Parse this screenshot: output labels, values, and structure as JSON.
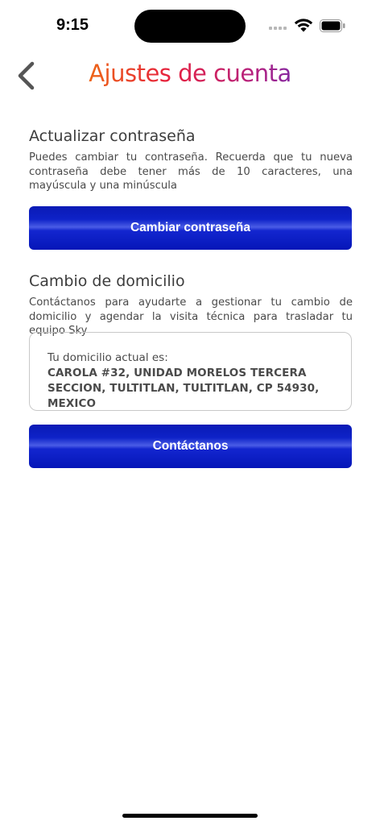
{
  "status_bar": {
    "time": "9:15"
  },
  "header": {
    "title": "Ajustes de cuenta",
    "back_icon": "chevron-left-icon"
  },
  "password_section": {
    "title": "Actualizar contraseña",
    "description": "Puedes cambiar tu contraseña. Recuerda que tu nueva contraseña debe tener más de 10 caracteres, una mayúscula y una minúscula",
    "button_label": "Cambiar contraseña"
  },
  "address_section": {
    "title": "Cambio de domicilio",
    "description": "Contáctanos para ayudarte a gestionar tu cambio de domicilio y agendar la visita técnica para trasladar tu equipo Sky",
    "current_label": "Tu domicilio actual es:",
    "current_address": "CAROLA #32, UNIDAD MORELOS TERCERA SECCION, TULTITLAN, TULTITLAN, CP 54930, MEXICO",
    "button_label": "Contáctanos"
  },
  "colors": {
    "button_blue": "#0e22c8",
    "title_gradient_start": "#f5a000",
    "title_gradient_end": "#1e59d8"
  }
}
